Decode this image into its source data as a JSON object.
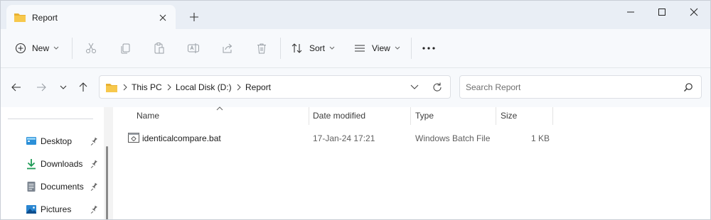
{
  "window": {
    "tab_title": "Report",
    "new_tab_icon": "plus-icon",
    "controls": [
      "minimize-icon",
      "maximize-icon",
      "close-icon"
    ]
  },
  "toolbar": {
    "new_label": "New",
    "sort_label": "Sort",
    "view_label": "View",
    "icons": [
      "new-icon",
      "cut-icon",
      "copy-icon",
      "paste-icon",
      "rename-icon",
      "share-icon",
      "delete-icon",
      "sort-icon",
      "view-icon",
      "more-icon"
    ]
  },
  "address": {
    "crumbs": [
      "This PC",
      "Local Disk (D:)",
      "Report"
    ],
    "search_placeholder": "Search Report"
  },
  "sidebar": {
    "items": [
      {
        "label": "Desktop",
        "icon": "desktop-icon"
      },
      {
        "label": "Downloads",
        "icon": "download-icon"
      },
      {
        "label": "Documents",
        "icon": "document-icon"
      },
      {
        "label": "Pictures",
        "icon": "picture-icon"
      }
    ]
  },
  "columns": {
    "name": "Name",
    "date": "Date modified",
    "type": "Type",
    "size": "Size"
  },
  "files": [
    {
      "name": "identicalcompare.bat",
      "date": "17-Jan-24 17:21",
      "type": "Windows Batch File",
      "size": "1 KB",
      "icon": "batch-file-icon"
    }
  ],
  "colors": {
    "titlebar": "#e9eef5",
    "toolbar": "#f7f9fc",
    "folder": "#f3c34a",
    "accent": "#1a73c9"
  }
}
